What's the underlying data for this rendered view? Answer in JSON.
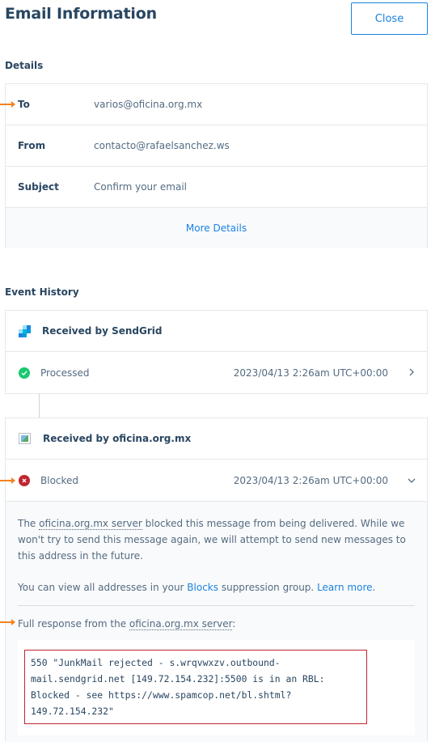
{
  "header": {
    "title": "Email Information",
    "close_label": "Close"
  },
  "details": {
    "label": "Details",
    "rows": [
      {
        "key": "To",
        "value": "varios@oficina.org.mx"
      },
      {
        "key": "From",
        "value": "contacto@rafaelsanchez.ws"
      },
      {
        "key": "Subject",
        "value": "Confirm your email"
      }
    ],
    "more_label": "More Details"
  },
  "events": {
    "label": "Event History",
    "groups": [
      {
        "source": "Received by SendGrid",
        "status": "Processed",
        "time": "2023/04/13 2:26am UTC+00:00"
      },
      {
        "source": "Received by oficina.org.mx",
        "status": "Blocked",
        "time": "2023/04/13 2:26am UTC+00:00",
        "explanation": {
          "pre": "The ",
          "server": "oficina.org.mx server",
          "post": " blocked this message from being delivered. While we won't try to send this message again, we will attempt to send new messages to this address in the future.",
          "blocks_pre": "You can view all addresses in your ",
          "blocks_link": "Blocks",
          "blocks_mid": " suppression group. ",
          "learn_more": "Learn more",
          "blocks_end": ".",
          "response_pre": "Full response from the ",
          "response_server": "oficina.org.mx server",
          "response_post": ":",
          "response": "550 \"JunkMail rejected - s.wrqvwxzv.outbound-mail.sendgrid.net [149.72.154.232]:5500 is in an RBL: Blocked - see https://www.spamcop.net/bl.shtml?149.72.154.232\""
        }
      }
    ]
  },
  "colors": {
    "accent": "#1a82e2",
    "annotation": "#f58220",
    "success": "#18c96e",
    "error": "#c1242f"
  }
}
